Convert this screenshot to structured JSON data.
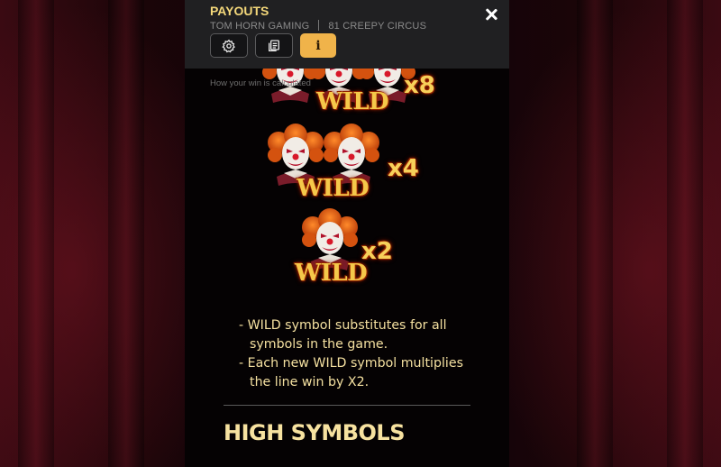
{
  "header": {
    "title": "PAYOUTS",
    "provider": "TOM HORN GAMING",
    "game": "81 CREEPY CIRCUS",
    "tabs": [
      {
        "name": "settings",
        "icon": "gear-icon",
        "active": false
      },
      {
        "name": "paytable",
        "icon": "pages-icon",
        "active": false
      },
      {
        "name": "info",
        "icon": "info-icon",
        "active": true
      }
    ],
    "info_glyph": "i"
  },
  "caption": "How your win is calculated",
  "symbols": [
    {
      "label": "WILD",
      "multiplier": "x8"
    },
    {
      "label": "WILD",
      "multiplier": "x4"
    },
    {
      "label": "WILD",
      "multiplier": "x2"
    }
  ],
  "rules": [
    "- WILD symbol substitutes for all symbols in the game.",
    "- Each new WILD symbol multiplies the line win by X2."
  ],
  "section_title": "HIGH SYMBOLS",
  "colors": {
    "accent": "#f0b34a",
    "title": "#f3d77a",
    "body_text": "#f4e0a0",
    "header_bg": "#202022",
    "panel_bg": "#050203"
  }
}
